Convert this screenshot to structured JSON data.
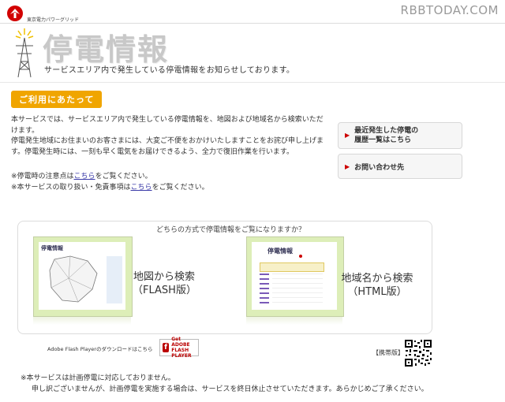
{
  "header": {
    "company_name": "東京電力パワーグリッド",
    "watermark": "RBBTODAY.COM",
    "page_title": "停電情報",
    "subtitle": "サービスエリア内で発生している停電情報をお知らせしております。"
  },
  "section": {
    "badge": "ご利用にあたって",
    "intro_lines": [
      "本サービスでは、サービスエリア内で発生している停電情報を、地図および地域名から検索いただ",
      "けます。",
      "停電発生地域にお住まいのお客さまには、大変ご不便をおかけいたしますことをお詫び申し上げま",
      "す。停電発生時には、一刻も早く電気をお届けできるよう、全力で復旧作業を行います。"
    ],
    "note1_pre": "※停電時の注意点は",
    "note1_link": "こちら",
    "note1_post": "をご覧ください。",
    "note2_pre": "※本サービスの取り扱い・免責事項は",
    "note2_link": "こちら",
    "note2_post": "をご覧ください。"
  },
  "sidebar": {
    "recent_line1": "最近発生した停電の",
    "recent_line2": "履歴一覧はこちら",
    "contact": "お問い合わせ先",
    "arrow": "▶"
  },
  "search": {
    "question": "どちらの方式で停電情報をご覧になりますか？",
    "map_title": "停電情報",
    "map_line1": "地図から検索",
    "map_line2": "（FLASH版）",
    "area_title": "停電情報",
    "area_line1": "地域名から検索",
    "area_line2": "（HTML版）"
  },
  "flash": {
    "download_text": "Adobe Flash Playerのダウンロードはこちら",
    "badge_line1": "Get ADOBE",
    "badge_line2": "FLASH PLAYER"
  },
  "mobile": {
    "label": "【携帯版】"
  },
  "footer": {
    "line1": "※本サービスは計画停電に対応しておりません。",
    "line2": "申し訳ございませんが、計画停電を実施する場合は、サービスを終日休止させていただきます。あらかじめご了承ください。"
  },
  "icons": {
    "logo": "tepco-logo-icon",
    "tower": "power-tower-icon",
    "qr": "qr-code-icon"
  },
  "colors": {
    "badge": "#f0a500",
    "link": "#3a3aa8",
    "arrow": "#cc0000",
    "title": "#c8c8c8"
  }
}
